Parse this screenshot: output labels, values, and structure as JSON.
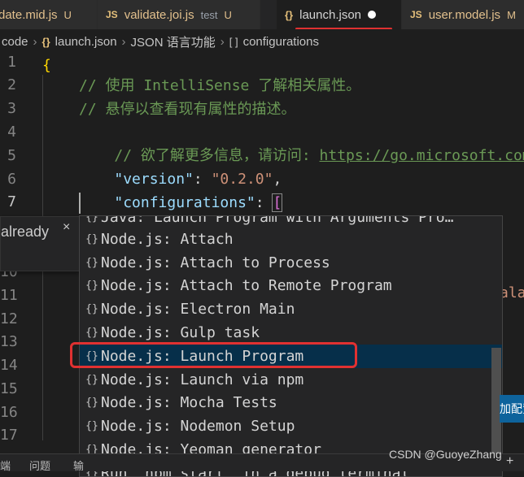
{
  "tabs": [
    {
      "label": "date.mid.js",
      "status": "U"
    },
    {
      "label": "validate.joi.js",
      "desc": "test",
      "status": "U"
    },
    {
      "label": "launch.json",
      "active": true
    },
    {
      "label": "user.model.js",
      "status": "M"
    }
  ],
  "breadcrumb": [
    "code",
    "launch.json",
    "JSON 语言功能",
    "configurations"
  ],
  "line_numbers": [
    "1",
    "2",
    "3",
    "4",
    "5",
    "6",
    "7",
    "10",
    "11",
    "12",
    "13",
    "14",
    "15",
    "16",
    "17"
  ],
  "code": {
    "l1": "{",
    "l2": "// 使用 IntelliSense 了解相关属性。",
    "l3": "// 悬停以查看现有属性的描述。",
    "l4_prefix": "// 欲了解更多信息，请访问: ",
    "l4_link": "https://go.microsoft.com",
    "l5_key": "\"version\"",
    "l5_val": "\"0.2.0\"",
    "l6_key": "\"configurations\"",
    "partial_right": "ala"
  },
  "notification": {
    "text": "already",
    "close": "×"
  },
  "suggestions": [
    "Java: Launch Program with Arguments Pro…",
    "Node.js: Attach",
    "Node.js: Attach to Process",
    "Node.js: Attach to Remote Program",
    "Node.js: Electron Main",
    "Node.js: Gulp task",
    "Node.js: Launch Program",
    "Node.js: Launch via npm",
    "Node.js: Mocha Tests",
    "Node.js: Nodemon Setup",
    "Node.js: Yeoman generator",
    "Run \"npm start\" in a debug terminal"
  ],
  "suggest_icon": "{}",
  "right_button": "加配置",
  "panel": {
    "t1": "端",
    "t2": "问题",
    "t3": "输",
    "plus": "+"
  },
  "watermark": "CSDN @GuoyeZhang",
  "colors": {
    "highlight": "#e03131",
    "accent": "#0e639c"
  }
}
